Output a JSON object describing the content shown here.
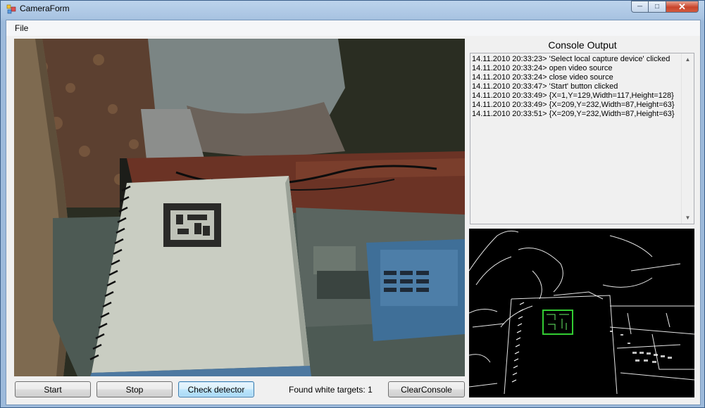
{
  "window": {
    "title": "CameraForm"
  },
  "menu": {
    "file_label": "File"
  },
  "console": {
    "title": "Console Output",
    "lines": [
      "14.11.2010 20:33:23> 'Select local capture device' clicked",
      "14.11.2010 20:33:24> open video source",
      "14.11.2010 20:33:24> close video source",
      "14.11.2010 20:33:47> 'Start' button clicked",
      "14.11.2010 20:33:49> {X=1,Y=129,Width=117,Height=128}",
      "14.11.2010 20:33:49> {X=209,Y=232,Width=87,Height=63}",
      "14.11.2010 20:33:51> {X=209,Y=232,Width=87,Height=63}"
    ]
  },
  "buttons": {
    "start": "Start",
    "stop": "Stop",
    "check": "Check detector",
    "clear": "ClearConsole"
  },
  "status": {
    "label": "Found white targets:",
    "count": "1"
  },
  "colors": {
    "detection_box": "#33cc33",
    "accent": "#3c7fb1"
  }
}
